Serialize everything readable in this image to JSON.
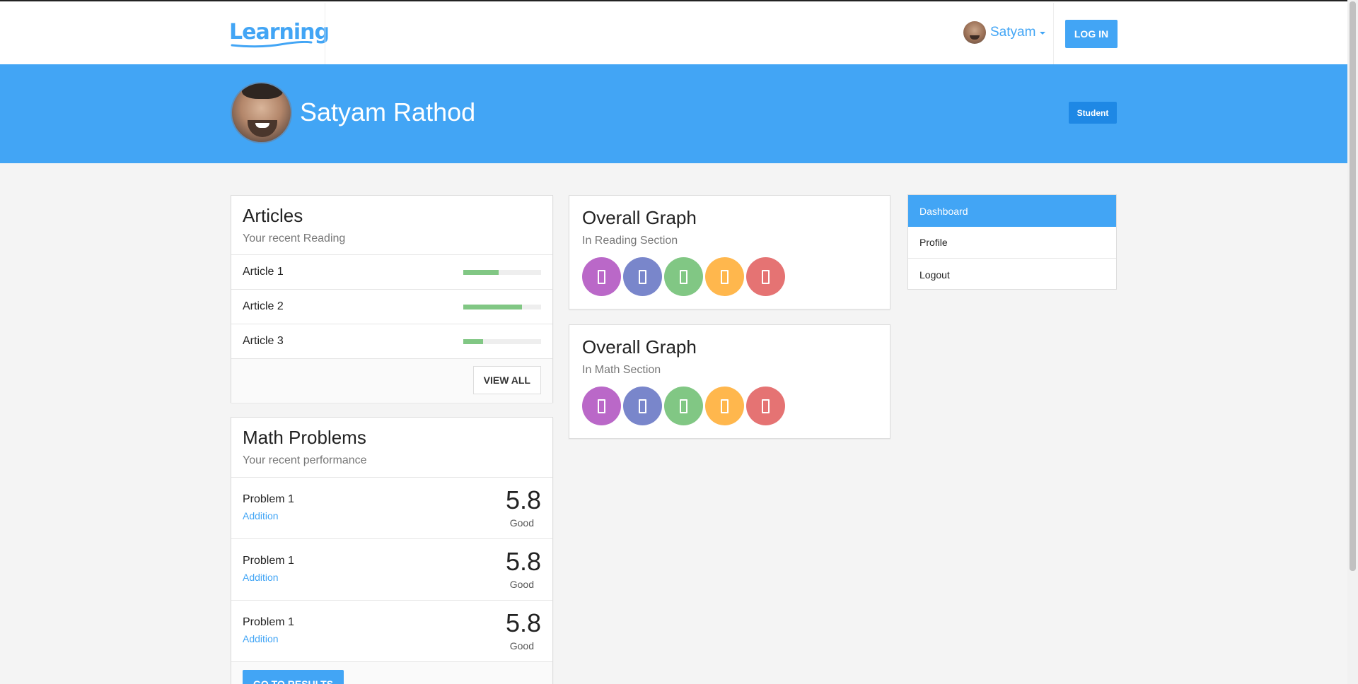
{
  "navbar": {
    "logo_text": "Learning",
    "user_name": "Satyam",
    "login_label": "LOG IN"
  },
  "profile": {
    "full_name": "Satyam Rathod",
    "role_badge": "Student"
  },
  "articles": {
    "title": "Articles",
    "subtitle": "Your recent Reading",
    "items": [
      {
        "name": "Article 1",
        "progress": 0.45
      },
      {
        "name": "Article 2",
        "progress": 0.75
      },
      {
        "name": "Article 3",
        "progress": 0.25
      }
    ],
    "view_all_label": "VIEW ALL"
  },
  "math": {
    "title": "Math Problems",
    "subtitle": "Your recent performance",
    "items": [
      {
        "name": "Problem 1",
        "type": "Addition",
        "score": "5.8",
        "grade": "Good"
      },
      {
        "name": "Problem 1",
        "type": "Addition",
        "score": "5.8",
        "grade": "Good"
      },
      {
        "name": "Problem 1",
        "type": "Addition",
        "score": "5.8",
        "grade": "Good"
      }
    ],
    "results_label": "GO TO RESULTS"
  },
  "graphs": [
    {
      "title": "Overall Graph",
      "subtitle": "In Reading Section"
    },
    {
      "title": "Overall Graph",
      "subtitle": "In Math Section"
    }
  ],
  "graph_circle_colors": [
    "#ba68c8",
    "#7986cb",
    "#81c784",
    "#ffb74d",
    "#e57373"
  ],
  "sidebar": {
    "items": [
      {
        "label": "Dashboard",
        "active": true
      },
      {
        "label": "Profile",
        "active": false
      },
      {
        "label": "Logout",
        "active": false
      }
    ]
  }
}
